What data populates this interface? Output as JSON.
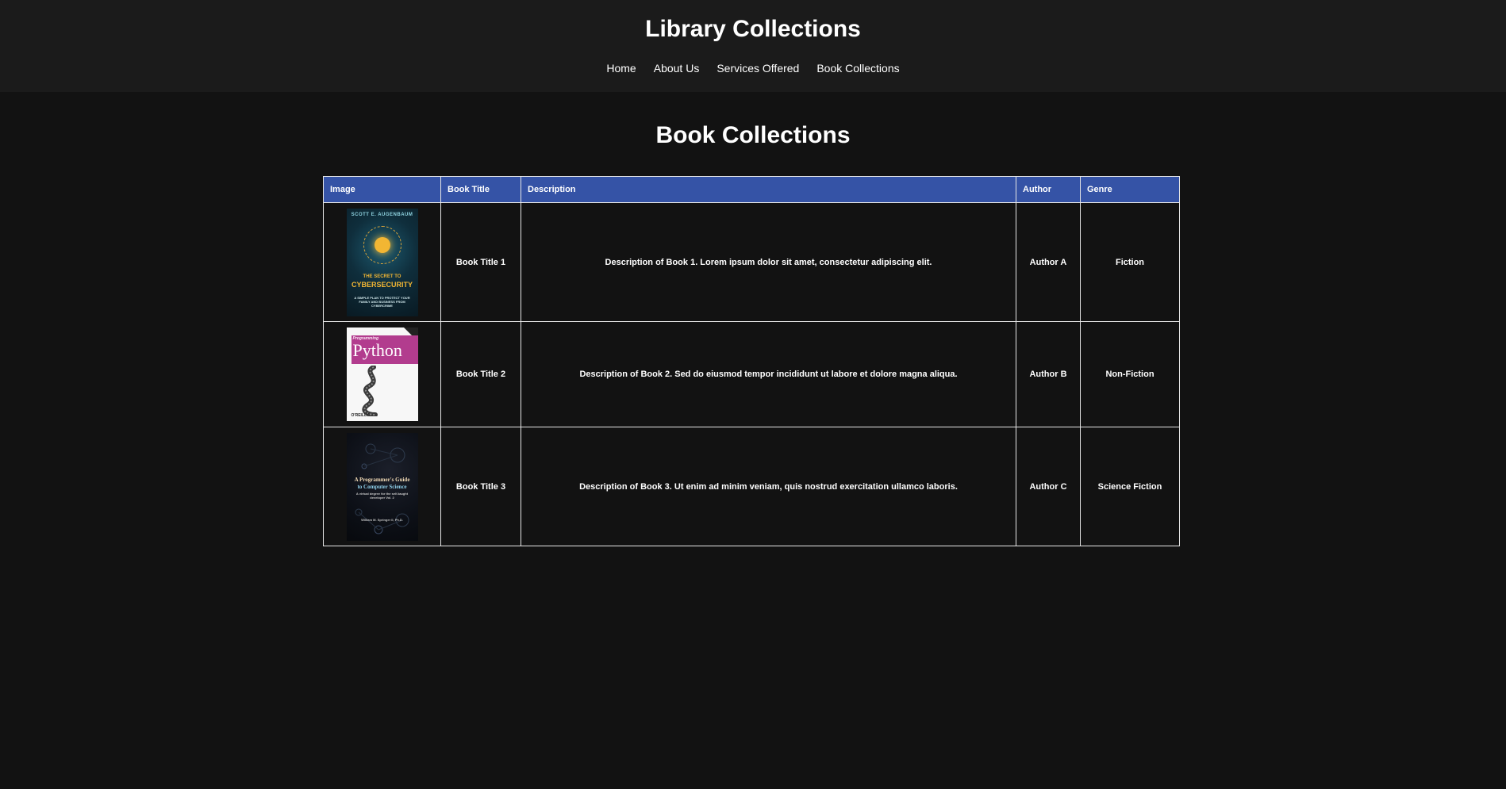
{
  "header": {
    "title": "Library Collections",
    "nav": [
      "Home",
      "About Us",
      "Services Offered",
      "Book Collections"
    ]
  },
  "main": {
    "title": "Book Collections",
    "table": {
      "headers": [
        "Image",
        "Book Title",
        "Description",
        "Author",
        "Genre"
      ],
      "rows": [
        {
          "cover": "cybersecurity-cover",
          "title": "Book Title 1",
          "description": "Description of Book 1. Lorem ipsum dolor sit amet, consectetur adipiscing elit.",
          "author": "Author A",
          "genre": "Fiction",
          "cover_text": {
            "author": "SCOTT E. AUGENBAUM",
            "pre": "THE SECRET TO",
            "title": "CYBERSECURITY",
            "sub": "A SIMPLE PLAN TO PROTECT YOUR FAMILY AND BUSINESS FROM CYBERCRIME"
          }
        },
        {
          "cover": "python-cover",
          "title": "Book Title 2",
          "description": "Description of Book 2. Sed do eiusmod tempor incididunt ut labore et dolore magna aliqua.",
          "author": "Author B",
          "genre": "Non-Fiction",
          "cover_text": {
            "pre": "Programming",
            "title": "Python",
            "publisher": "O'REILLY"
          }
        },
        {
          "cover": "programmers-guide-cover",
          "title": "Book Title 3",
          "description": "Description of Book 3. Ut enim ad minim veniam, quis nostrud exercitation ullamco laboris.",
          "author": "Author C",
          "genre": "Science Fiction",
          "cover_text": {
            "line1": "A Programmer's Guide",
            "line2": "to Computer Science",
            "line3": "A virtual degree for the self-taught developer Vol. 2",
            "author": "William M. Springer II, Ph.D."
          }
        }
      ]
    }
  },
  "colors": {
    "background": "#121212",
    "header_bg": "#1b1b1b",
    "table_header": "#3553a6",
    "border": "#e6e6e6"
  }
}
